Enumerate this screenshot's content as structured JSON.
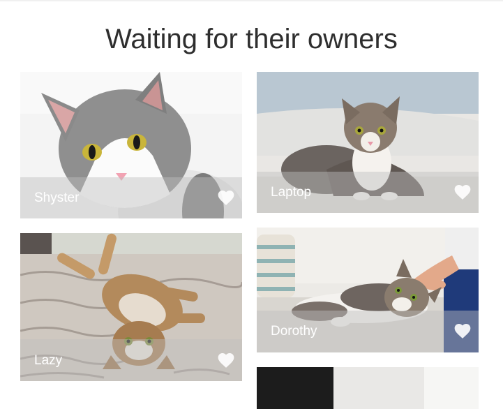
{
  "page": {
    "title": "Waiting for their owners"
  },
  "cards": [
    {
      "name": "Shyster",
      "photo_icon": "gray-white-cat-photo",
      "heart_icon": "heart-icon"
    },
    {
      "name": "Laptop",
      "photo_icon": "tabby-cat-on-bed-photo",
      "heart_icon": "heart-icon"
    },
    {
      "name": "Lazy",
      "photo_icon": "tabby-cat-lying-on-back-photo",
      "heart_icon": "heart-icon"
    },
    {
      "name": "Dorothy",
      "photo_icon": "cat-being-petted-photo",
      "heart_icon": "heart-icon"
    }
  ],
  "colors": {
    "title": "#2e2e2e",
    "overlay": "rgba(190,190,190,0.45)",
    "label": "#ffffff"
  }
}
